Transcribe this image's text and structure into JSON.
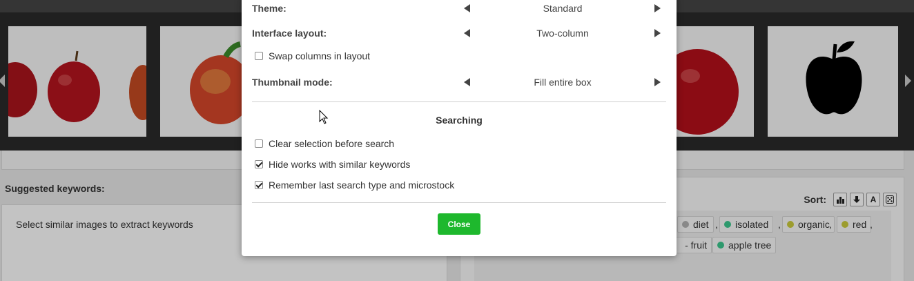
{
  "modal": {
    "settings": [
      {
        "label": "Theme:",
        "value": "Standard"
      },
      {
        "label": "Interface layout:",
        "value": "Two-column"
      },
      {
        "label": "Thumbnail mode:",
        "value": "Fill entire box"
      }
    ],
    "swap_columns": {
      "label": "Swap columns in layout",
      "checked": false
    },
    "searching": {
      "title": "Searching",
      "options": [
        {
          "label": "Clear selection before search",
          "checked": false
        },
        {
          "label": "Hide works with similar keywords",
          "checked": true
        },
        {
          "label": "Remember last search type and microstock",
          "checked": true
        }
      ]
    },
    "close_label": "Close",
    "accent_color": "#1eb82d"
  },
  "background": {
    "suggested_keywords_title": "Suggested keywords:",
    "suggested_placeholder": "Select similar images to extract keywords",
    "sort_label": "Sort:",
    "sort_alpha_label": "A",
    "keywords": [
      {
        "text": "diet",
        "dot": "#b0b0b0"
      },
      {
        "text": "isolated",
        "dot": "#3cc48c"
      },
      {
        "text": "organic",
        "dot": "#c8c83c"
      },
      {
        "text": "red",
        "dot": "#c8c83c"
      },
      {
        "text": "- fruit",
        "dot": ""
      },
      {
        "text": "apple tree",
        "dot": "#3cc48c"
      }
    ],
    "separator": ","
  }
}
